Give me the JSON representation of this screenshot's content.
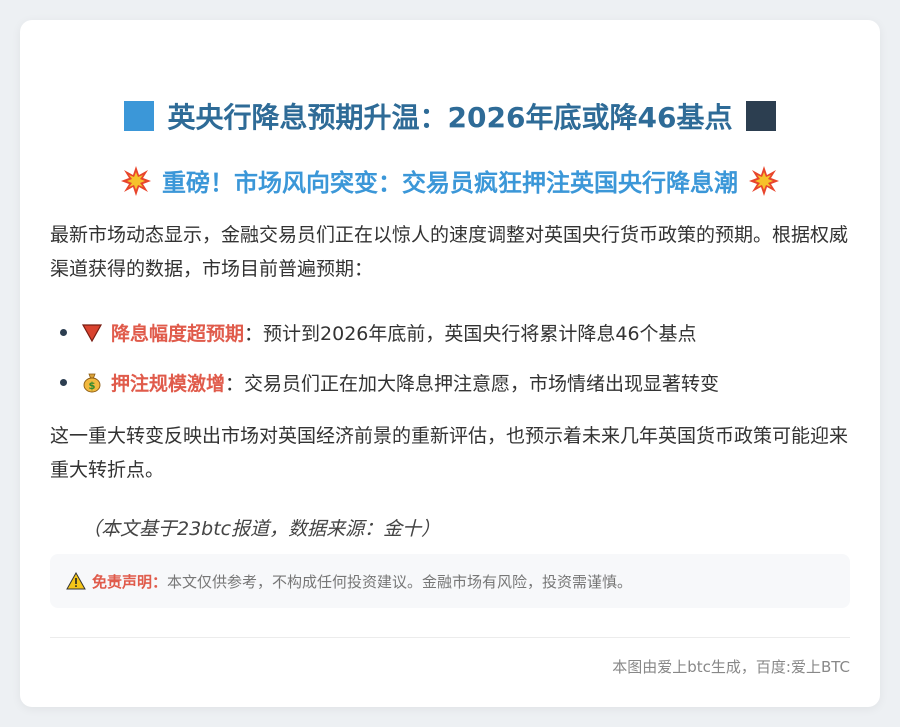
{
  "title": "英央行降息预期升温：2026年底或降46基点",
  "subtitle": "重磅！市场风向突变：交易员疯狂押注英国央行降息潮",
  "intro": "最新市场动态显示，金融交易员们正在以惊人的速度调整对英国央行货币政策的预期。根据权威渠道获得的数据，市场目前普遍预期：",
  "bullets": [
    {
      "icon": "red-down-triangle-icon",
      "label": "降息幅度超预期",
      "text": "：预计到2026年底前，英国央行将累计降息46个基点"
    },
    {
      "icon": "money-bag-icon",
      "label": "押注规模激增",
      "text": "：交易员们正在加大降息押注意愿，市场情绪出现显著转变"
    }
  ],
  "conclusion": "这一重大转变反映出市场对英国经济前景的重新评估，也预示着未来几年英国货币政策可能迎来重大转折点。",
  "source": "（本文基于23btc报道，数据来源：金十）",
  "disclaimer": {
    "label": "免责声明：",
    "text": "本文仅供参考，不构成任何投资建议。金融市场有风险，投资需谨慎。"
  },
  "footer": "本图由爱上btc生成，百度:爱上BTC",
  "colors": {
    "title": "#2e6b97",
    "subtitle": "#3b97d8",
    "highlight": "#e05b4b",
    "accent_square": "#3b97d8",
    "dark_square": "#2c3e50"
  }
}
